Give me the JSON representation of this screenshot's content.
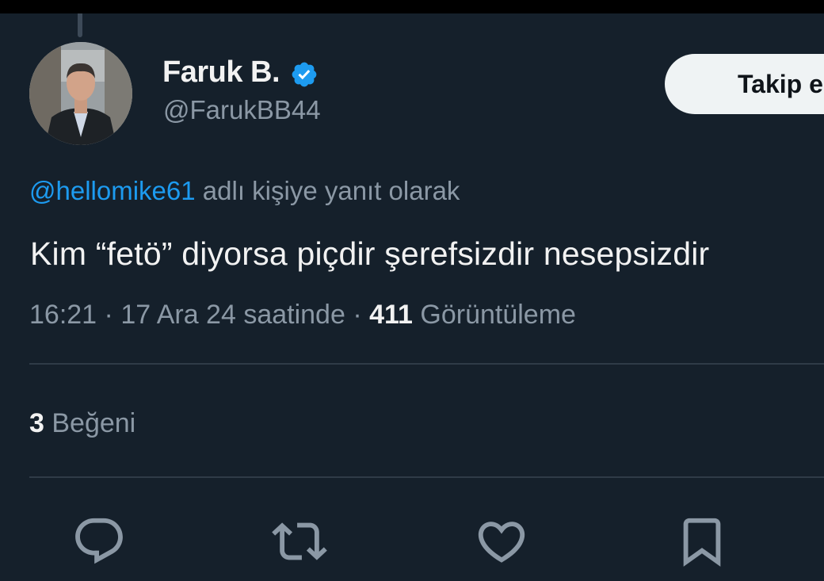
{
  "author": {
    "display_name": "Faruk B.",
    "handle": "@FarukBB44",
    "verified": true,
    "verified_color": "#1d9bf0"
  },
  "follow_button": {
    "label": "Takip e"
  },
  "reply_context": {
    "mention": "@hellomike61",
    "suffix": " adlı kişiye yanıt olarak"
  },
  "tweet": {
    "text": "Kim “fetö” diyorsa piçdir şerefsizdir nesepsizdir"
  },
  "meta": {
    "time": "16:21",
    "separator": " · ",
    "date": "17 Ara 24 saatinde",
    "separator2": " · ",
    "views_count": "411",
    "views_label": " Görüntüleme"
  },
  "stats": {
    "likes_count": "3",
    "likes_label": " Beğeni"
  },
  "actions": [
    {
      "name": "reply",
      "icon": "reply-icon"
    },
    {
      "name": "retweet",
      "icon": "retweet-icon"
    },
    {
      "name": "like",
      "icon": "heart-icon"
    },
    {
      "name": "bookmark",
      "icon": "bookmark-icon"
    }
  ],
  "colors": {
    "background": "#15202b",
    "accent": "#1d9bf0",
    "muted_text": "#8b98a5",
    "primary_text": "#f2f2f2"
  }
}
